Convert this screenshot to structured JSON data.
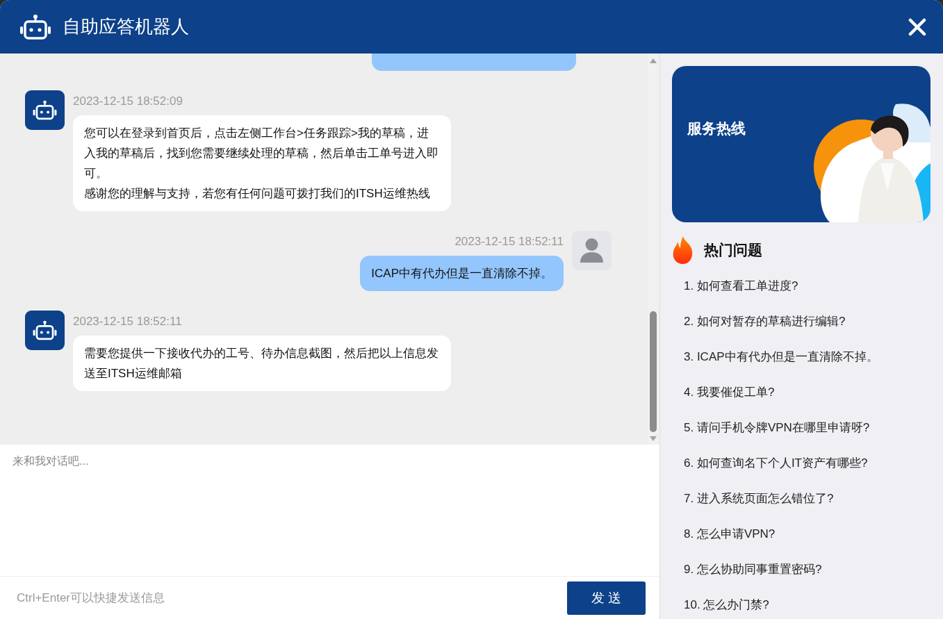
{
  "window": {
    "title": "自助应答机器人"
  },
  "messages": [
    {
      "kind": "user"
    },
    {
      "kind": "bot",
      "time": "2023-12-15 18:52:09",
      "paragraphs": [
        "您可以在登录到首页后，点击左侧工作台>任务跟踪>我的草稿，进入我的草稿后，找到您需要继续处理的草稿，然后单击工单号进入即可。",
        "感谢您的理解与支持，若您有任何问题可拨打我们的ITSH运维热线"
      ]
    },
    {
      "kind": "user",
      "time": "2023-12-15 18:52:11",
      "paragraphs": [
        "ICAP中有代办但是一直清除不掉。"
      ]
    },
    {
      "kind": "bot",
      "time": "2023-12-15 18:52:11",
      "paragraphs": [
        "需要您提供一下接收代办的工号、待办信息截图，然后把以上信息发送至ITSH运维邮箱"
      ]
    }
  ],
  "input": {
    "placeholder": "来和我对话吧...",
    "hint": "Ctrl+Enter可以快捷发送信息",
    "send_button": "发 送"
  },
  "banner": {
    "title": "服务热线"
  },
  "hot_questions": {
    "title": "热门问题",
    "items": [
      "1. 如何查看工单进度?",
      "2. 如何对暂存的草稿进行编辑?",
      "3. ICAP中有代办但是一直清除不掉。",
      "4. 我要催促工单?",
      "5. 请问手机令牌VPN在哪里申请呀?",
      "6. 如何查询名下个人IT资产有哪些?",
      "7. 进入系统页面怎么错位了?",
      "8. 怎么申请VPN?",
      "9. 怎么协助同事重置密码?",
      "10. 怎么办门禁?"
    ]
  }
}
